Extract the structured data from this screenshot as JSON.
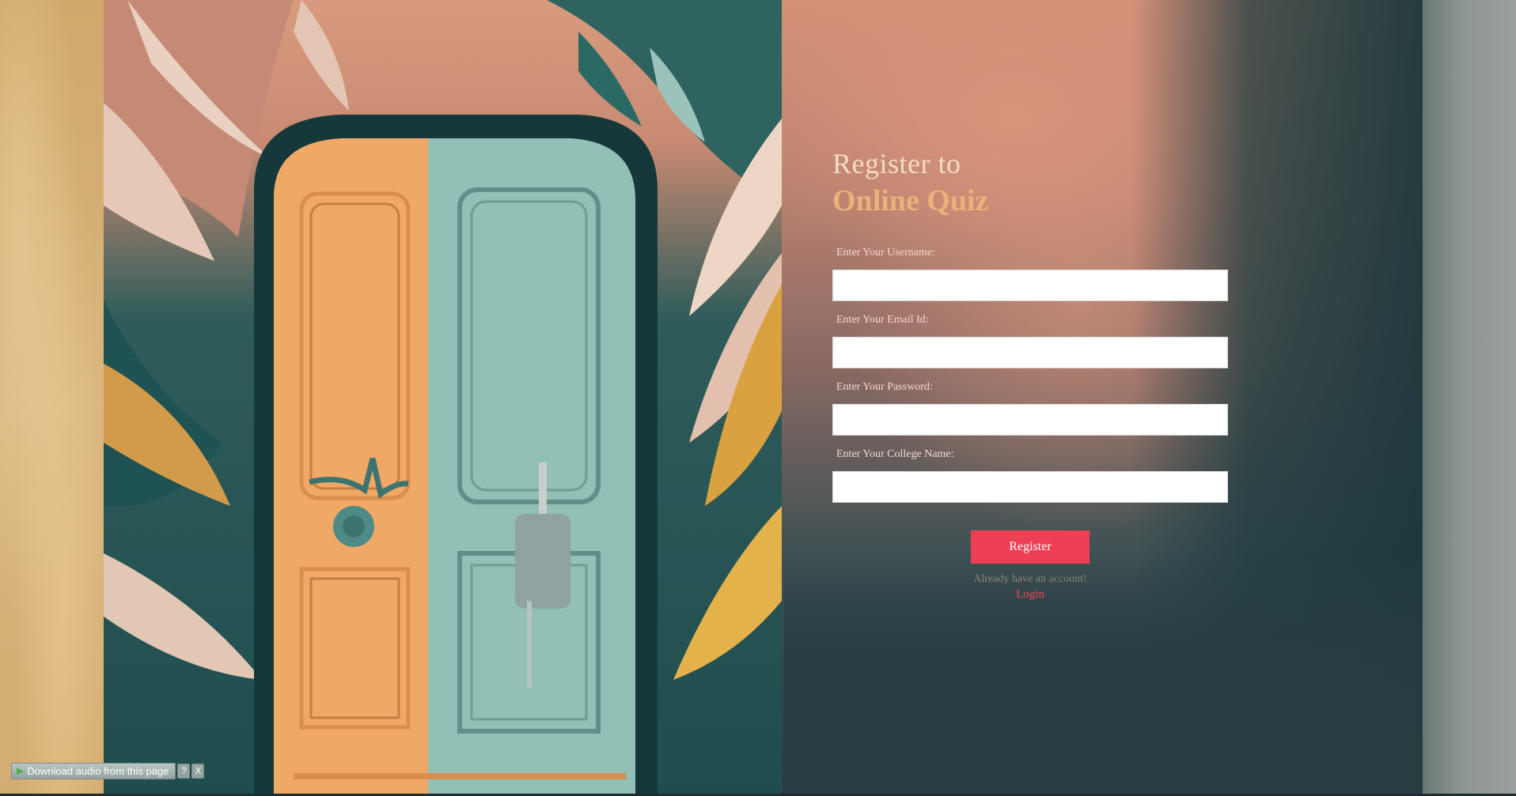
{
  "form": {
    "title_line1": "Register to",
    "title_line2": "Online Quiz",
    "fields": [
      {
        "label": "Enter Your Username:",
        "value": "",
        "type": "text"
      },
      {
        "label": "Enter Your Email Id:",
        "value": "",
        "type": "email"
      },
      {
        "label": "Enter Your Password:",
        "value": "",
        "type": "password"
      },
      {
        "label": "Enter Your College Name:",
        "value": "",
        "type": "text"
      }
    ],
    "register_label": "Register",
    "already_text": "Already have an account!",
    "login_label": "Login"
  },
  "extension": {
    "download_label": "Download audio from this page",
    "help_label": "?",
    "close_label": "X"
  },
  "colors": {
    "accent": "#ee4055",
    "title_primary": "#f3dcc0",
    "title_secondary": "#e8b27a"
  },
  "icons": {
    "play": "play-icon",
    "help": "help-icon",
    "close": "close-icon"
  }
}
